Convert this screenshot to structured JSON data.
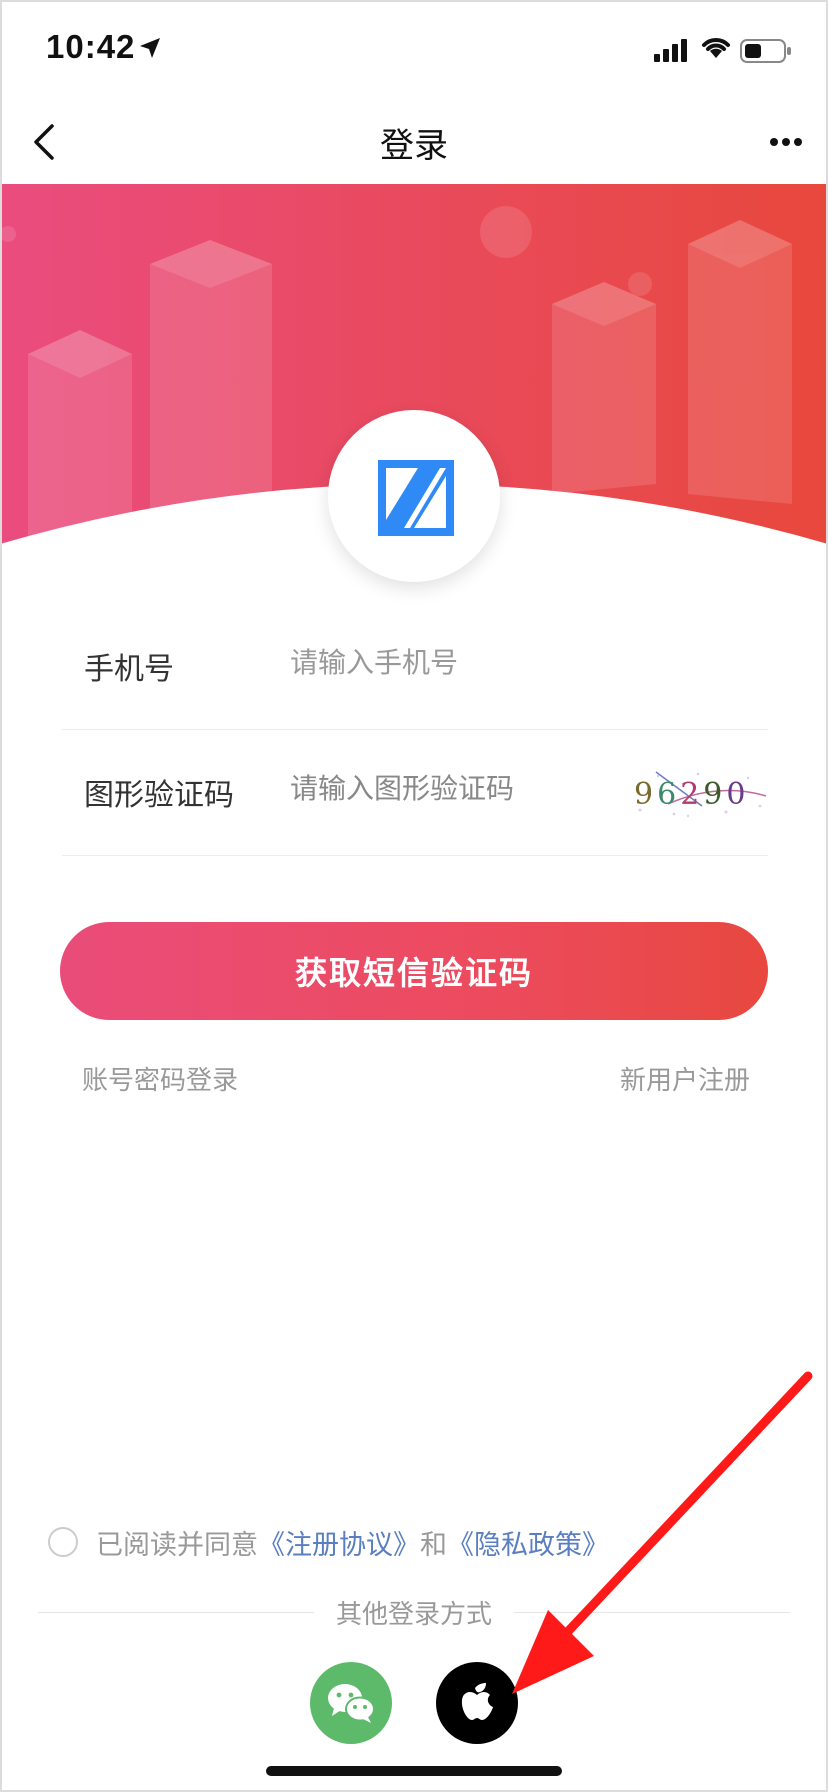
{
  "status_bar": {
    "time": "10:42"
  },
  "nav": {
    "title": "登录"
  },
  "form": {
    "phone_label": "手机号",
    "phone_placeholder": "请输入手机号",
    "captcha_label": "图形验证码",
    "captcha_placeholder": "请输入图形验证码",
    "captcha_code": "96290"
  },
  "actions": {
    "sms_button": "获取短信验证码",
    "password_login": "账号密码登录",
    "register": "新用户注册"
  },
  "agreement": {
    "prefix": "已阅读并同意",
    "terms": "《注册协议》",
    "and": "和",
    "privacy": "《隐私政策》"
  },
  "other_login": {
    "label": "其他登录方式"
  },
  "colors": {
    "banner_start": "#ea4c7f",
    "banner_end": "#e8483c",
    "logo_blue": "#2f8af5",
    "wechat_green": "#5cba6a",
    "link_blue": "#5a7fc1",
    "arrow_red": "#ff1a1a"
  },
  "icons": [
    "location-arrow-icon",
    "signal-icon",
    "wifi-icon",
    "battery-icon",
    "back-chevron-icon",
    "more-dots-icon",
    "app-logo-icon",
    "wechat-icon",
    "apple-icon"
  ]
}
